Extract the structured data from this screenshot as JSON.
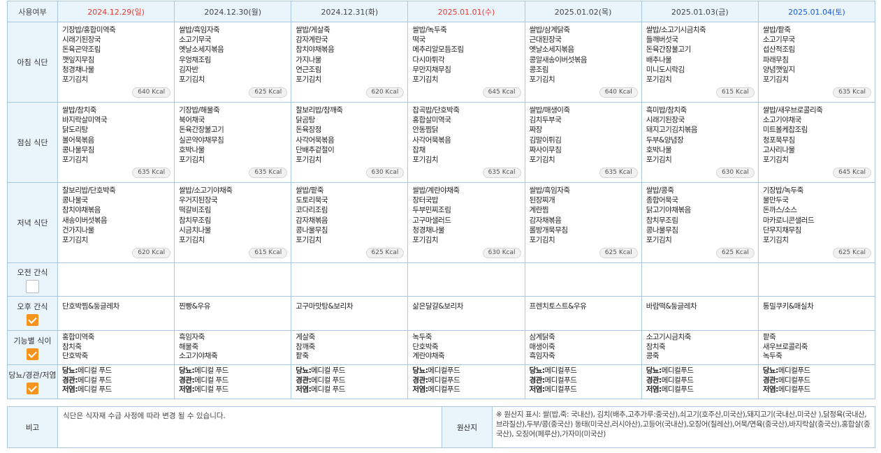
{
  "header": {
    "usage_label": "사용여부",
    "dates": [
      {
        "label": "2024.12.29(일)",
        "color": "red"
      },
      {
        "label": "2024.12.30(월)",
        "color": "normal"
      },
      {
        "label": "2024.12.31(화)",
        "color": "normal"
      },
      {
        "label": "2025.01.01(수)",
        "color": "red"
      },
      {
        "label": "2025.01.02(목)",
        "color": "normal"
      },
      {
        "label": "2025.01.03(금)",
        "color": "normal"
      },
      {
        "label": "2025.01.04(토)",
        "color": "blue"
      }
    ]
  },
  "rows": {
    "breakfast": {
      "label": "아침 식단",
      "days": [
        {
          "items": [
            "기장밥/홍합미역죽",
            "시래기된장국",
            "돈육곤약조림",
            "깻잎지무침",
            "청경채나물",
            "포기김치"
          ],
          "kcal": "640 Kcal"
        },
        {
          "items": [
            "쌀밥/흑임자죽",
            "소고기무국",
            "옛날소세지볶음",
            "우엉채조림",
            "김자반",
            "포기김치"
          ],
          "kcal": "625 Kcal"
        },
        {
          "items": [
            "쌀밥/게살죽",
            "감자계란국",
            "참치야채볶음",
            "가지나물",
            "연근조림",
            "포기김치"
          ],
          "kcal": "620 Kcal"
        },
        {
          "items": [
            "쌀밥/녹두죽",
            "떡국",
            "메추리알모듬조림",
            "다시마튀각",
            "무만지채무침",
            "포기김치"
          ],
          "kcal": "645 Kcal"
        },
        {
          "items": [
            "쌀밥/삼계닭죽",
            "근대된장국",
            "옛날소세지볶음",
            "콩알새송이버섯볶음",
            "콩조림",
            "포기김치"
          ],
          "kcal": "640 Kcal"
        },
        {
          "items": [
            "쌀밥/소고기시금치죽",
            "들깨버섯국",
            "돈육간장불고기",
            "배추나물",
            "미니도시락김",
            "포기김치"
          ],
          "kcal": "615 Kcal"
        },
        {
          "items": [
            "쌀밥/팥죽",
            "소고기무국",
            "섭산적조림",
            "파래무침",
            "양념깻잎지",
            "포기김치"
          ],
          "kcal": "635 Kcal"
        }
      ]
    },
    "lunch": {
      "label": "점심 식단",
      "days": [
        {
          "items": [
            "쌀밥/참치죽",
            "바지락살미역국",
            "닭도리탕",
            "볼어묵볶음",
            "콩나물무침",
            "포기김치"
          ],
          "kcal": "635 Kcal"
        },
        {
          "items": [
            "기장밥/해물죽",
            "북어채국",
            "돈육간장불고기",
            "실곤약야채무침",
            "호박나물",
            "포기김치"
          ],
          "kcal": "635 Kcal"
        },
        {
          "items": [
            "찰보리밥/참깨죽",
            "닭곰탕",
            "돈육장정",
            "사각어묵볶음",
            "단배추겉절이",
            "포기김치"
          ],
          "kcal": "630 Kcal"
        },
        {
          "items": [
            "잡곡밥/단호박죽",
            "홍합살미역국",
            "안동찜닭",
            "사각어묵볶음",
            "잡채",
            "포기김치"
          ],
          "kcal": "635 Kcal"
        },
        {
          "items": [
            "쌀밥/매생이죽",
            "김치두부국",
            "짜장",
            "김말이튀김",
            "짜사이무침",
            "포기김치"
          ],
          "kcal": "635 Kcal"
        },
        {
          "items": [
            "흑미밥/참치죽",
            "시래기된장국",
            "돼지고기김치볶음",
            "두부&양념장",
            "호박나물",
            "포기김치"
          ],
          "kcal": "630 Kcal"
        },
        {
          "items": [
            "쌀밥/새우브로콜리죽",
            "소고기야채국",
            "미트볼케찹조림",
            "청포묵무침",
            "고사리나물",
            "포기김치"
          ],
          "kcal": "645 Kcal"
        }
      ]
    },
    "dinner": {
      "label": "저녁 식단",
      "days": [
        {
          "items": [
            "찰보리밥/단호박죽",
            "콩나물국",
            "참치야채볶음",
            "새송이버섯볶음",
            "건가지나물",
            "포기김치"
          ],
          "kcal": "620 Kcal"
        },
        {
          "items": [
            "쌀밥/소고기야채죽",
            "우거지된장국",
            "떡갈비조림",
            "참치무조림",
            "시금치나물",
            "포기김치"
          ],
          "kcal": "615 Kcal"
        },
        {
          "items": [
            "쌀밥/팥죽",
            "도토리묵국",
            "코다리조림",
            "감자채볶음",
            "콩나물무침",
            "포기김치"
          ],
          "kcal": "625 Kcal"
        },
        {
          "items": [
            "쌀밥/계란야채죽",
            "장터국밥",
            "두부민찌조림",
            "고구마샐러드",
            "청경채나물",
            "포기김치"
          ],
          "kcal": "630 Kcal"
        },
        {
          "items": [
            "쌀밥/흑임자죽",
            "된장찌개",
            "계란찜",
            "감자채볶음",
            "롤방개묵무침",
            "포기김치"
          ],
          "kcal": "625 Kcal"
        },
        {
          "items": [
            "쌀밥/콩죽",
            "종합어묵국",
            "닭고기야채볶음",
            "참치무조림",
            "콩나물무침",
            "포기김치"
          ],
          "kcal": "625 Kcal"
        },
        {
          "items": [
            "기장밥/녹두죽",
            "물만두국",
            "돈까스/소스",
            "마카로니콘샐러드",
            "단무지채무침",
            "포기김치"
          ],
          "kcal": "625 Kcal"
        }
      ]
    },
    "am_snack": {
      "label": "오전 간식",
      "checked": false,
      "days": [
        "",
        "",
        "",
        "",
        "",
        "",
        ""
      ]
    },
    "pm_snack": {
      "label": "오후 간식",
      "checked": true,
      "days": [
        "단호박찜&둥글레차",
        "찐빵&우유",
        "고구마맛탕&보리차",
        "삶은달걀&보리차",
        "프렌치토스트&우유",
        "바람떡&둥글레차",
        "통밀쿠키&매실차"
      ]
    },
    "functional": {
      "label": "기능별 식이",
      "checked": true,
      "days": [
        [
          "홍합미역죽",
          "참치죽",
          "단호박죽"
        ],
        [
          "흑임자죽",
          "해물죽",
          "소고기야채죽"
        ],
        [
          "게살죽",
          "참깨죽",
          "팥죽"
        ],
        [
          "녹두죽",
          "단호박죽",
          "계란야채죽"
        ],
        [
          "삼계닭죽",
          "매생이죽",
          "흑임자죽"
        ],
        [
          "소고기시금치죽",
          "참치죽",
          "콩죽"
        ],
        [
          "팥죽",
          "새우브로콜리죽",
          "녹두죽"
        ]
      ]
    },
    "diet": {
      "label": "당뇨/경관/저염",
      "checked": true,
      "keys": [
        "당뇨:",
        "경관:",
        "저염:"
      ],
      "days": [
        [
          "메디컬 푸드",
          "메디컬 푸드",
          "메디컬 푸드"
        ],
        [
          "메디컬 푸드",
          "메디컬 푸드",
          "메디컬 푸드"
        ],
        [
          "메디컬 푸드",
          "메디컬 푸드",
          "메디컬 푸드"
        ],
        [
          "메디컬푸드",
          "메디컬푸드",
          "메디컬푸드"
        ],
        [
          "메디컬푸드",
          "메디컬푸드",
          "메디컬푸드"
        ],
        [
          "메디컬푸드",
          "메디컬푸드",
          "메디컬푸드"
        ],
        [
          "메디컬푸드",
          "메디컬푸드",
          "메디컬푸드"
        ]
      ]
    }
  },
  "note": {
    "label": "비고",
    "text": "식단은 식자재 수급 사정에 따라 변경 될 수 있습니다.",
    "origin_label": "원산지",
    "origin_text": "※ 원산지 표시: 쌀(밥,죽: 국내산), 김치(배추,고추가루:중국산),쇠고기(호주산,미국산),돼지고기(국내산,미국산 ),닭정육(국내산,브라질산),두부/콩(중국산) 동태(미국산,러시아산),고등어(국내산),오징어(칠레산),어묵/연육(중국산),바지락살(중국산),홍합살(중국산), 오징어(페루산),가자미(미국산)"
  },
  "colors": {
    "accent_check": "#f7941d",
    "header_bg": "#e9f4fb",
    "border": "#a9c7e3",
    "sunday_red": "#e53935",
    "saturday_blue": "#1e5bd6"
  }
}
